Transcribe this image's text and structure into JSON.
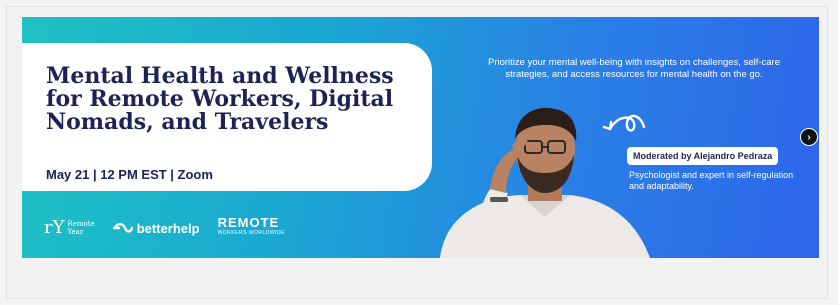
{
  "banner": {
    "title": "Mental Health and Wellness for Remote Workers, Digital Nomads, and Travelers",
    "event_meta": "May 21 | 12 PM EST | Zoom",
    "promo_text": "Prioritize your mental well-being with insights on challenges, self-care strategies, and access resources for mental health on the go.",
    "moderator_tag": "Moderated by Alejandro Pedraza",
    "moderator_desc": "Psychologist and expert in self-regulation and adaptability.",
    "logos": {
      "remote_year_mark": "rY",
      "remote_year_words": [
        "Remote",
        "Year"
      ],
      "betterhelp": "betterhelp",
      "remote_workers": "REMOTE",
      "remote_workers_sub": "WORKERS WORLDWIDE"
    },
    "colors": {
      "gradient_start": "#1ec2c2",
      "gradient_end": "#2d66ea",
      "title_color": "#1d2354"
    }
  },
  "carousel": {
    "next_label": "›"
  }
}
